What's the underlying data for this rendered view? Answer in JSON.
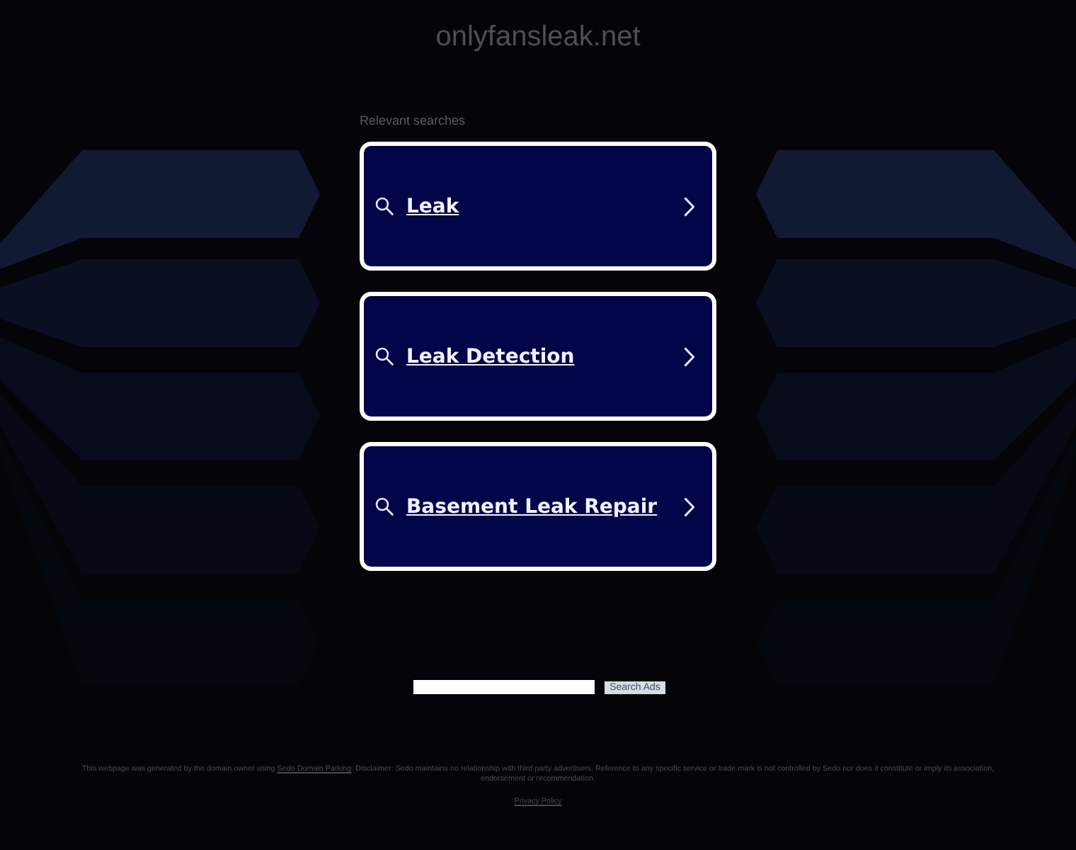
{
  "header": {
    "domain": "onlyfansleak.net"
  },
  "related": {
    "heading": "Relevant searches",
    "links": [
      {
        "label": "Leak"
      },
      {
        "label": "Leak Detection"
      },
      {
        "label": "Basement Leak Repair"
      }
    ]
  },
  "search": {
    "button": "Search Ads"
  },
  "footer": {
    "disclaimer": [
      {
        "kind": "text",
        "text": "This webpage was generated by the domain owner using "
      },
      {
        "kind": "link",
        "text": "Sedo Domain Parking"
      },
      {
        "kind": "text",
        "text": ". Disclaimer: Sedo maintains no relationship with third party advertisers. Reference to any specific service or trade mark is not controlled by Sedo nor does it constitute or imply its association, endorsement or recommendation."
      }
    ],
    "privacy": "Privacy Policy"
  }
}
